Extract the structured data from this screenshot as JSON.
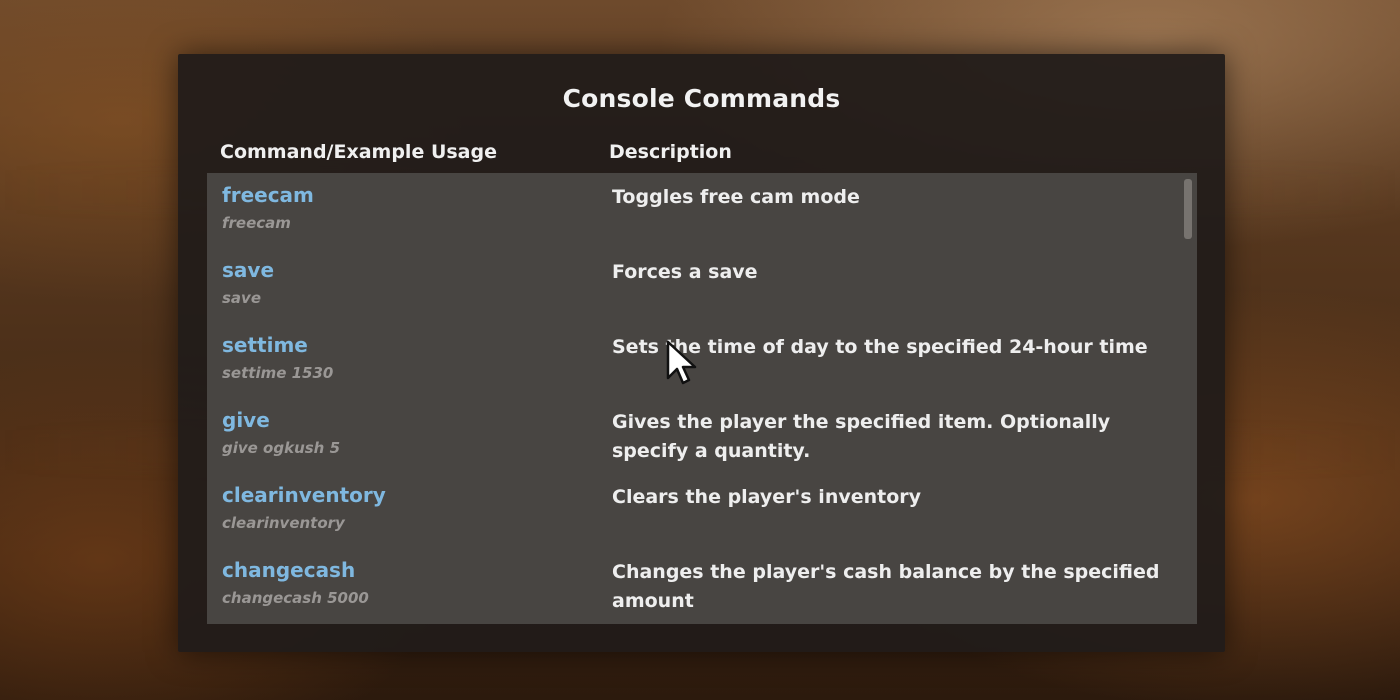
{
  "console": {
    "title": "Console Commands",
    "headers": {
      "command": "Command/Example Usage",
      "description": "Description"
    },
    "commands": [
      {
        "name": "freecam",
        "example": "freecam",
        "description": "Toggles free cam mode"
      },
      {
        "name": "save",
        "example": "save",
        "description": "Forces a save"
      },
      {
        "name": "settime",
        "example": "settime 1530",
        "description": "Sets the time of day to the specified 24-hour time"
      },
      {
        "name": "give",
        "example": "give ogkush 5",
        "description": "Gives the player the specified item. Optionally specify a quantity."
      },
      {
        "name": "clearinventory",
        "example": "clearinventory",
        "description": "Clears the player's inventory"
      },
      {
        "name": "changecash",
        "example": "changecash 5000",
        "description": "Changes the player's cash balance by the specified amount"
      }
    ]
  },
  "colors": {
    "command_name": "#7fb8e0",
    "example_text": "#9a9795",
    "list_background": "#484542",
    "panel_background": "#211c19"
  },
  "icons": {
    "cursor": "mouse-pointer-icon"
  }
}
